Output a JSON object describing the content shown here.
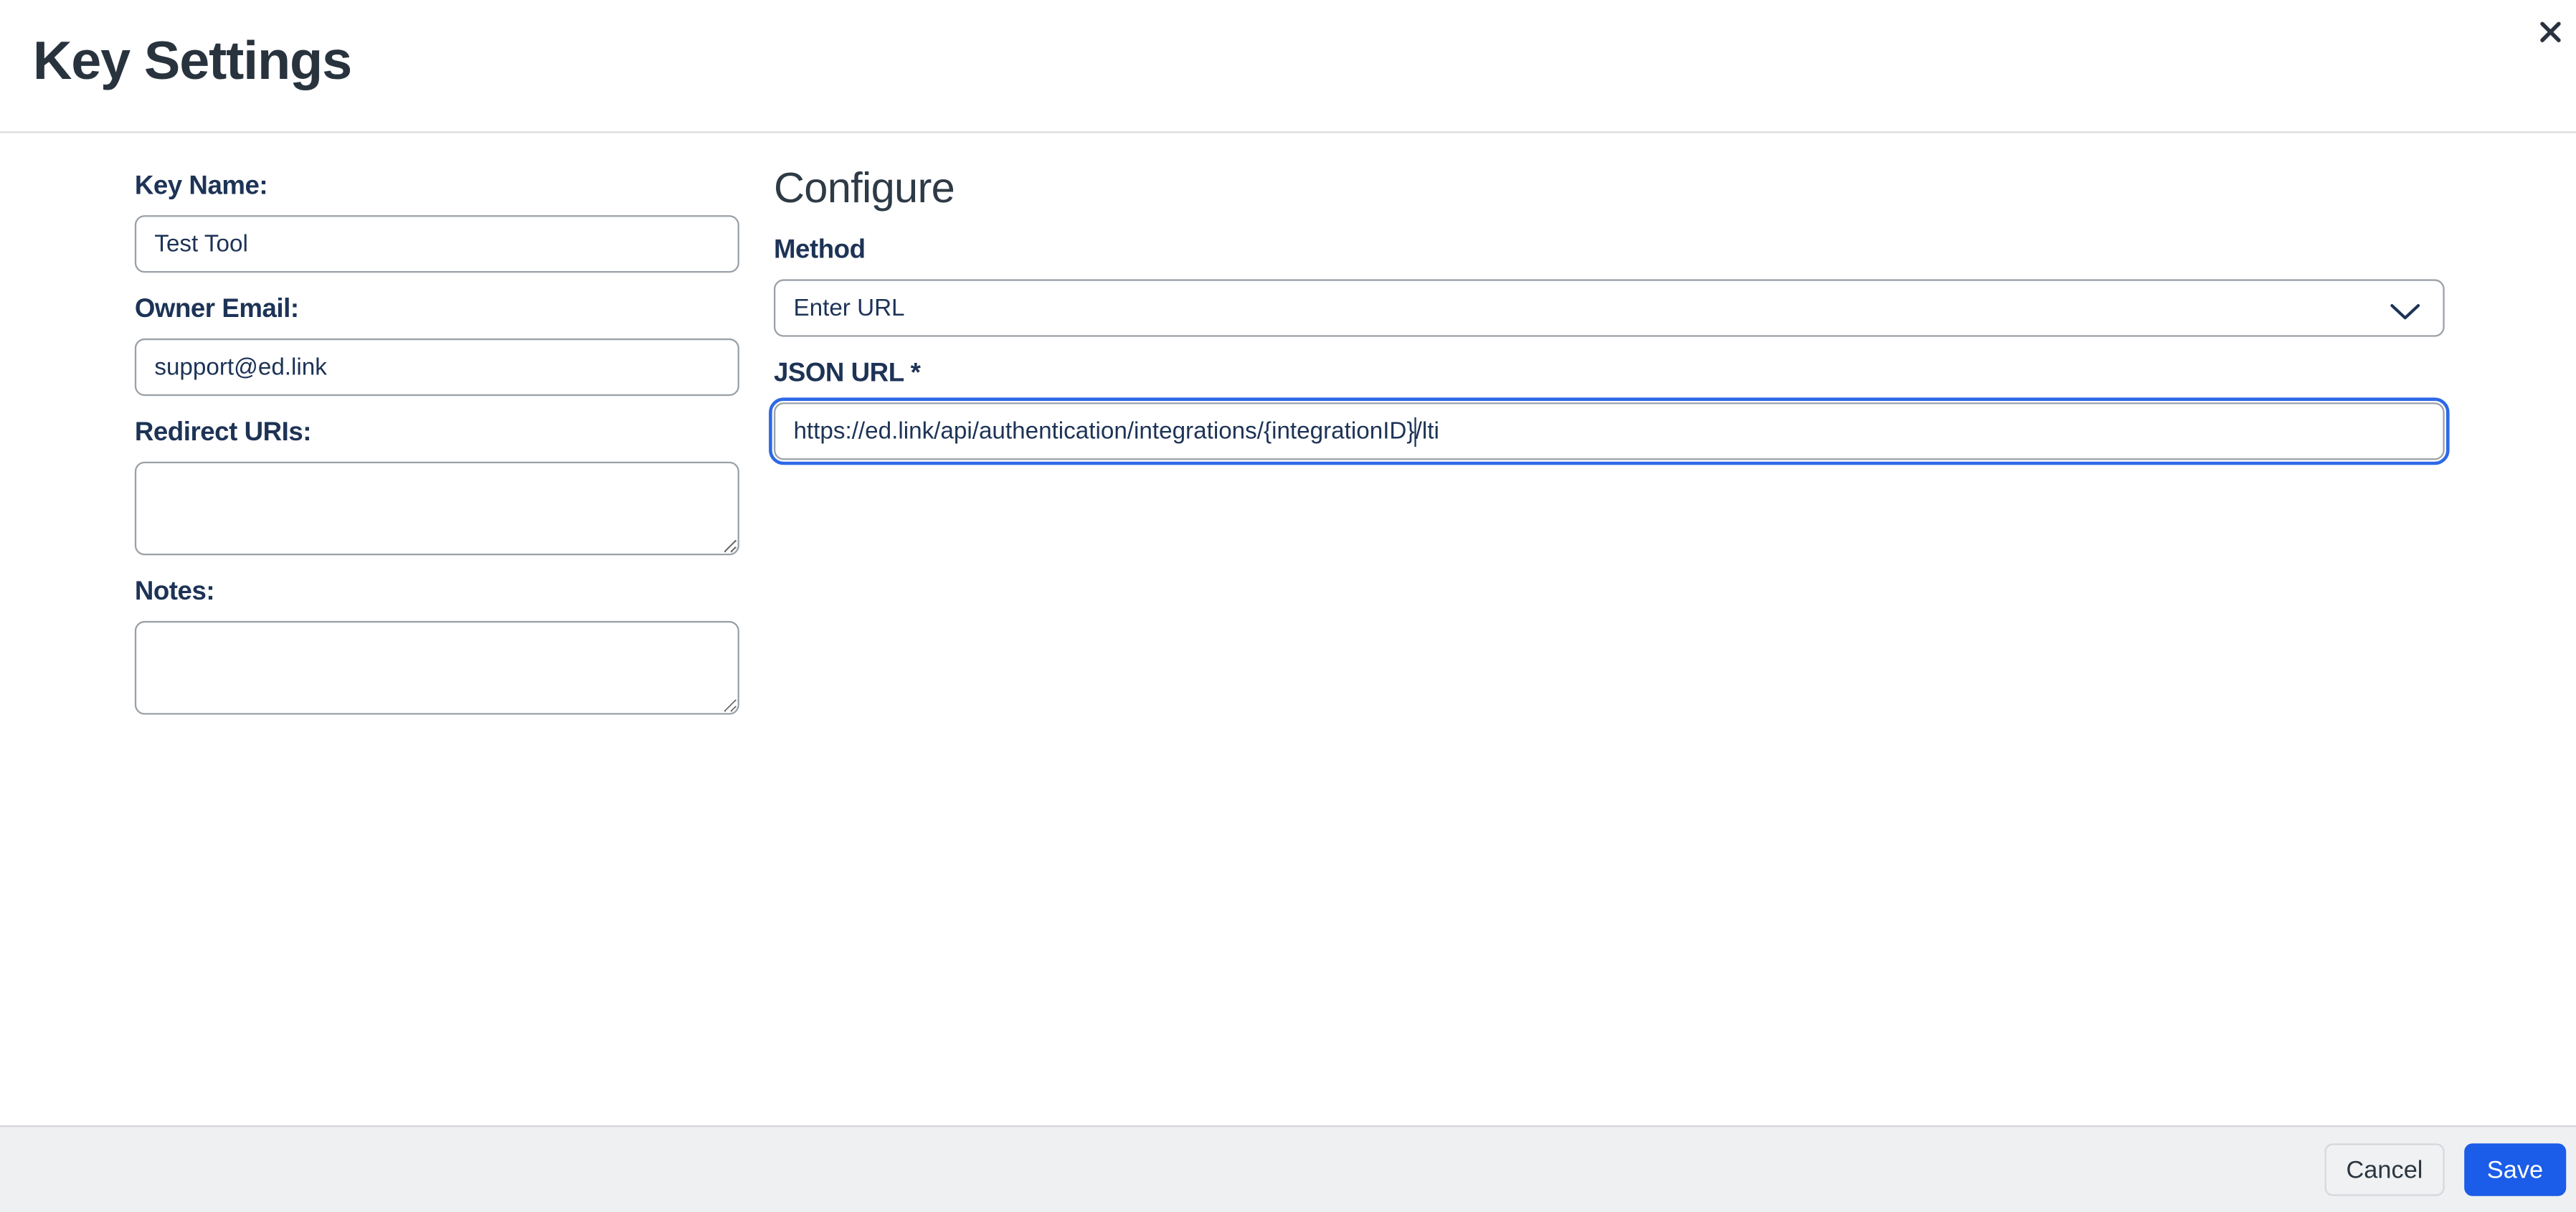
{
  "modal": {
    "title": "Key Settings"
  },
  "form": {
    "key_name": {
      "label": "Key Name:",
      "value": "Test Tool"
    },
    "owner_email": {
      "label": "Owner Email:",
      "value": "support@ed.link"
    },
    "redirect_uris": {
      "label": "Redirect URIs:",
      "value": ""
    },
    "notes": {
      "label": "Notes:",
      "value": ""
    }
  },
  "configure": {
    "heading": "Configure",
    "method": {
      "label": "Method",
      "selected": "Enter URL"
    },
    "json_url": {
      "label": "JSON URL *",
      "value": "https://ed.link/api/authentication/integrations/{integrationID}/lti",
      "value_before_caret": "https://ed.link/api/authentication/integrations/{integrationID}",
      "value_after_caret": "/lti"
    }
  },
  "footer": {
    "cancel_label": "Cancel",
    "save_label": "Save"
  },
  "icons": {
    "close": "close-icon",
    "chevron": "chevron-down-icon"
  },
  "colors": {
    "accent_blue": "#1b5ce8",
    "focus_ring_blue": "#2d68e8",
    "label_navy": "#1d3356",
    "title_slate": "#28333e",
    "input_border_gray": "#9aa1a8",
    "footer_bg": "#eff0f2",
    "header_divider": "#d9dcdf"
  }
}
